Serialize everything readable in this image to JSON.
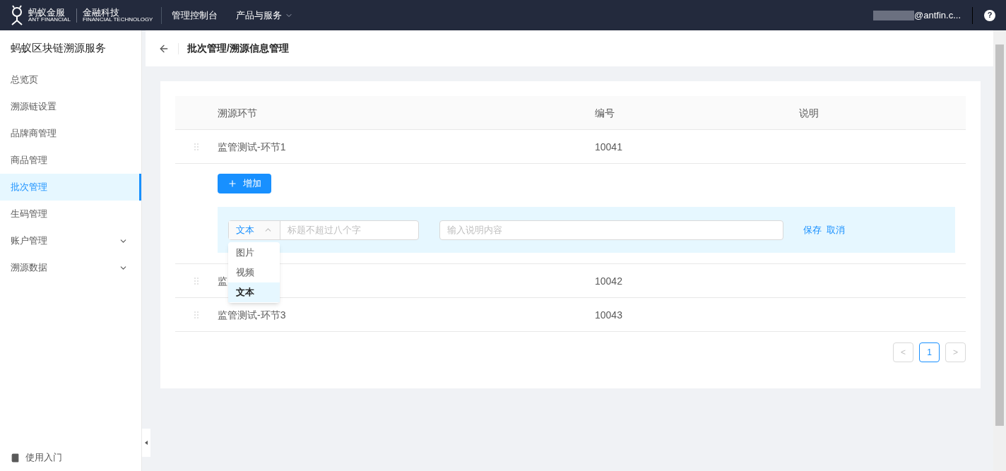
{
  "topbar": {
    "logo_text": "蚂蚁金服",
    "logo_sub": "ANT FINANCIAL",
    "brand": "金融科技",
    "brand_sub": "FINANCIAL TECHNOLOGY",
    "nav": [
      {
        "label": "管理控制台",
        "dropdown": false
      },
      {
        "label": "产品与服务",
        "dropdown": true
      }
    ],
    "user": "@antfin.c...",
    "help": "?"
  },
  "sidebar": {
    "title": "蚂蚁区块链溯源服务",
    "items": [
      {
        "label": "总览页",
        "selected": false,
        "expandable": false
      },
      {
        "label": "溯源链设置",
        "selected": false,
        "expandable": false
      },
      {
        "label": "品牌商管理",
        "selected": false,
        "expandable": false
      },
      {
        "label": "商品管理",
        "selected": false,
        "expandable": false
      },
      {
        "label": "批次管理",
        "selected": true,
        "expandable": false
      },
      {
        "label": "生码管理",
        "selected": false,
        "expandable": false
      },
      {
        "label": "账户管理",
        "selected": false,
        "expandable": true
      },
      {
        "label": "溯源数据",
        "selected": false,
        "expandable": true
      }
    ],
    "footer": "使用入门"
  },
  "header": {
    "title": "批次管理/溯源信息管理"
  },
  "table": {
    "columns": [
      "溯源环节",
      "编号",
      "说明"
    ],
    "rows": [
      {
        "name": "监管测试-环节1",
        "number": "10041"
      },
      {
        "name": "监",
        "number": "10042"
      },
      {
        "name": "监管测试-环节3",
        "number": "10043"
      }
    ],
    "add_button": "增加",
    "editor": {
      "type_value": "文本",
      "title_placeholder": "标题不超过八个字",
      "desc_placeholder": "输入说明内容",
      "save": "保存",
      "cancel": "取消",
      "options": [
        {
          "label": "图片",
          "selected": false
        },
        {
          "label": "视频",
          "selected": false
        },
        {
          "label": "文本",
          "selected": true
        }
      ]
    }
  },
  "pagination": {
    "prev": "<",
    "pages": [
      {
        "label": "1",
        "selected": true
      }
    ],
    "next": ">"
  }
}
